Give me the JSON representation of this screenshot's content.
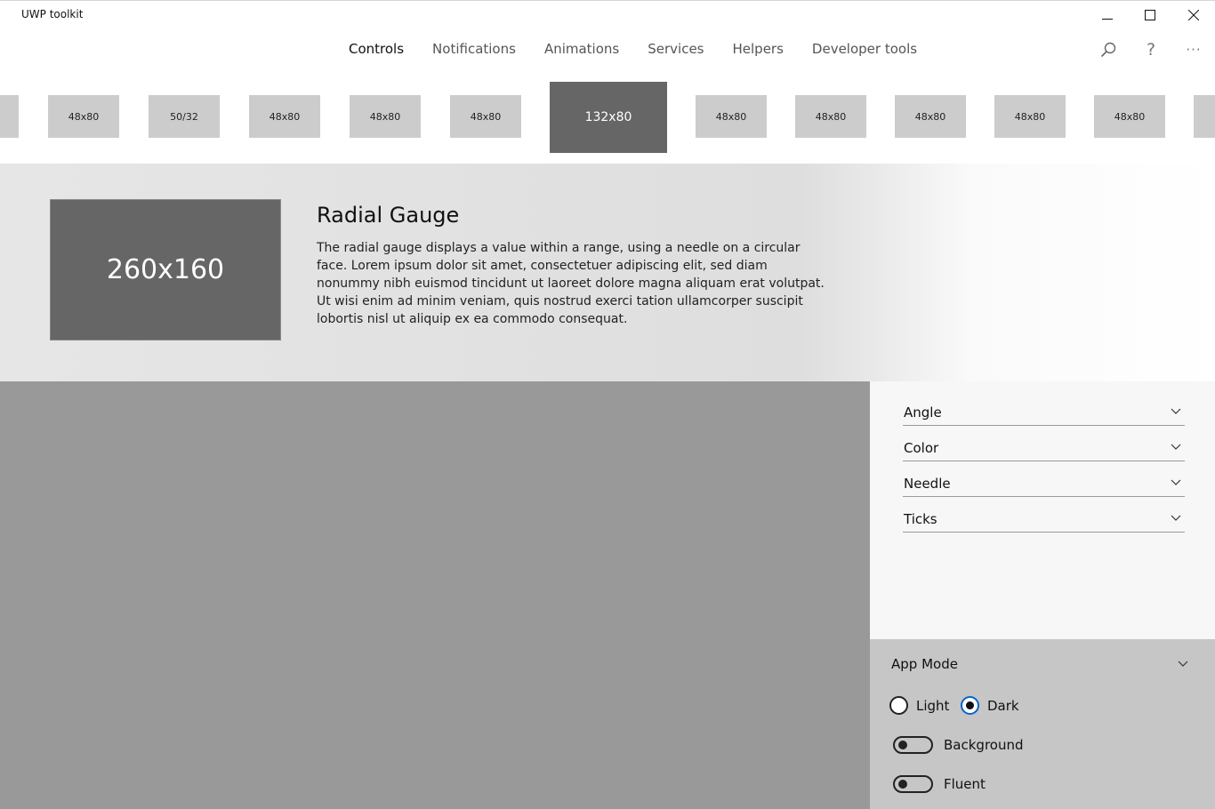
{
  "window": {
    "title": "UWP toolkit",
    "buttons": [
      {
        "name": "minimize-icon"
      },
      {
        "name": "maximize-icon"
      },
      {
        "name": "close-icon"
      }
    ]
  },
  "nav": {
    "tabs": [
      {
        "label": "Controls",
        "active": true
      },
      {
        "label": "Notifications"
      },
      {
        "label": "Animations"
      },
      {
        "label": "Services"
      },
      {
        "label": "Helpers"
      },
      {
        "label": "Developer tools"
      }
    ],
    "icons": [
      "search-icon",
      "help-icon",
      "more-icon"
    ],
    "help_glyph": "?",
    "more_glyph": "···"
  },
  "thumbnails": [
    {
      "label": ""
    },
    {
      "label": "48x80"
    },
    {
      "label": "50/32"
    },
    {
      "label": "48x80"
    },
    {
      "label": "48x80"
    },
    {
      "label": "48x80"
    },
    {
      "label": "132x80",
      "selected": true
    },
    {
      "label": "48x80"
    },
    {
      "label": "48x80"
    },
    {
      "label": "48x80"
    },
    {
      "label": "48x80"
    },
    {
      "label": "48x80"
    },
    {
      "label": ""
    }
  ],
  "header": {
    "image_label": "260x160",
    "title": "Radial Gauge",
    "description": "The radial gauge displays a value within a range, using a needle on a circular face. Lorem ipsum dolor sit amet, consectetuer adipiscing elit, sed diam nonummy nibh euismod tincidunt ut laoreet dolore magna aliquam erat volutpat. Ut wisi enim ad minim veniam, quis nostrud exerci tation ullamcorper suscipit lobortis nisl ut aliquip ex ea commodo consequat."
  },
  "properties": [
    {
      "label": "Angle"
    },
    {
      "label": "Color"
    },
    {
      "label": "Needle"
    },
    {
      "label": "Ticks"
    }
  ],
  "app_mode": {
    "title": "App Mode",
    "options": [
      {
        "label": "Light",
        "checked": false
      },
      {
        "label": "Dark",
        "checked": true
      }
    ],
    "toggles": [
      {
        "label": "Background",
        "on": false
      },
      {
        "label": "Fluent",
        "on": false
      }
    ]
  },
  "colors": {
    "accent": "#0a64c8",
    "preview_bg": "#999999",
    "thumb_bg": "#cccccc",
    "thumb_selected_bg": "#666666"
  }
}
